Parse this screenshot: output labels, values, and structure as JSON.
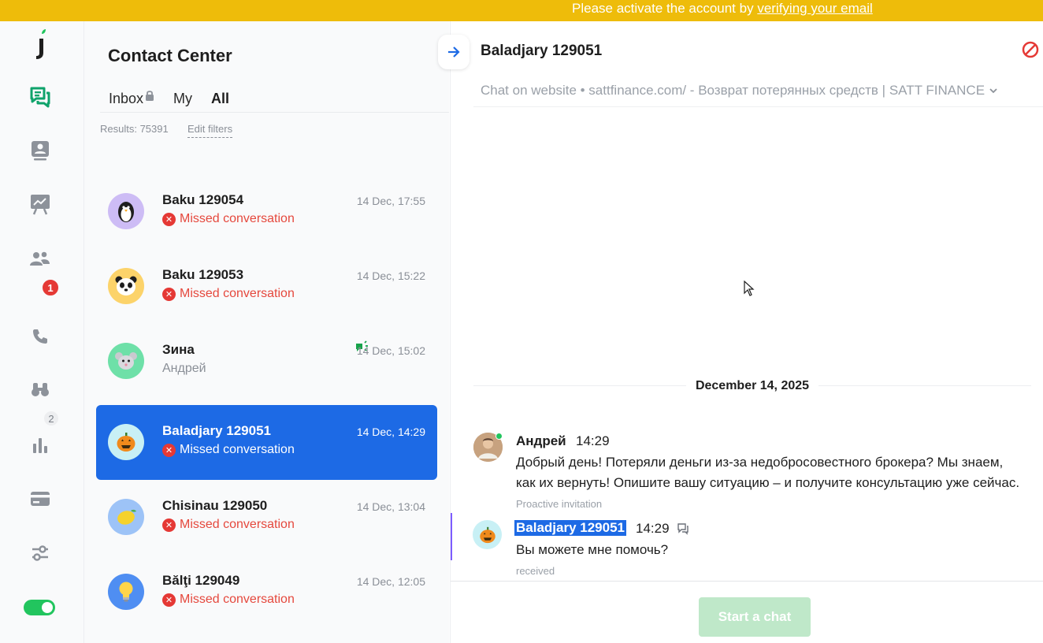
{
  "banner": {
    "text_prefix": "Please activate the account by ",
    "link_text": "verifying your email",
    "color": "#eebc0a"
  },
  "rail": {
    "items": [
      {
        "icon": "logo-icon"
      },
      {
        "icon": "chats-icon",
        "active": true
      },
      {
        "icon": "contacts-icon"
      },
      {
        "icon": "presentation-chart-icon"
      },
      {
        "icon": "team-icon",
        "badge": "1"
      },
      {
        "icon": "phone-icon"
      },
      {
        "icon": "binoculars-icon",
        "badge": "2"
      },
      {
        "icon": "reports-icon"
      },
      {
        "icon": "billing-card-icon"
      },
      {
        "icon": "settings-sliders-icon"
      }
    ],
    "team_badge": "1",
    "visitors_badge": "2",
    "status_toggle": "on"
  },
  "list": {
    "title": "Contact Center",
    "tabs": [
      {
        "label": "Inbox"
      },
      {
        "label": "My"
      },
      {
        "label": "All"
      }
    ],
    "active_tab": "All",
    "results": "Results: 75391",
    "edit_filters": "Edit filters",
    "conversations": [
      {
        "name": "Baku 129054",
        "time": "14 Dec, 17:55",
        "status": "Missed conversation",
        "avatar": "penguin",
        "avatar_bg": "#cdbcf5"
      },
      {
        "name": "Baku 129053",
        "time": "14 Dec, 15:22",
        "status": "Missed conversation",
        "avatar": "panda",
        "avatar_bg": "#fcd36a"
      },
      {
        "name": "Зина",
        "time": "14 Dec, 15:02",
        "status": "Андрей",
        "avatar": "mouse",
        "avatar_bg": "#6ee0a8"
      },
      {
        "name": "Baladjary 129051",
        "time": "14 Dec, 14:29",
        "status": "Missed conversation",
        "avatar": "pumpkin",
        "avatar_bg": "#c8f0f5",
        "selected": true
      },
      {
        "name": "Chisinau 129050",
        "time": "14 Dec, 13:04",
        "status": "Missed conversation",
        "avatar": "lemon",
        "avatar_bg": "#9dc3f7"
      },
      {
        "name": "Bălţi 129049",
        "time": "14 Dec, 12:05",
        "status": "Missed conversation",
        "avatar": "lightbulb",
        "avatar_bg": "#4f8ef2"
      }
    ]
  },
  "chat": {
    "title": "Baladjary 129051",
    "source": "Chat on website • sattfinance.com/ - Возврат потерянных средств | SATT FINANCE",
    "date": "December 14, 2025",
    "messages": [
      {
        "author": "Андрей",
        "time": "14:29",
        "text_line1": "Добрый день! Потеряли деньги из-за недобросовестного брокера? Мы знаем,",
        "text_line2": "как их вернуть! Опишите вашу ситуацию – и получите консультацию уже сейчас.",
        "meta": "Proactive invitation"
      },
      {
        "author": "Baladjary 129051",
        "time": "14:29",
        "text": "Вы можете мне помочь?",
        "meta": "received"
      }
    ],
    "start_button": "Start a chat"
  }
}
